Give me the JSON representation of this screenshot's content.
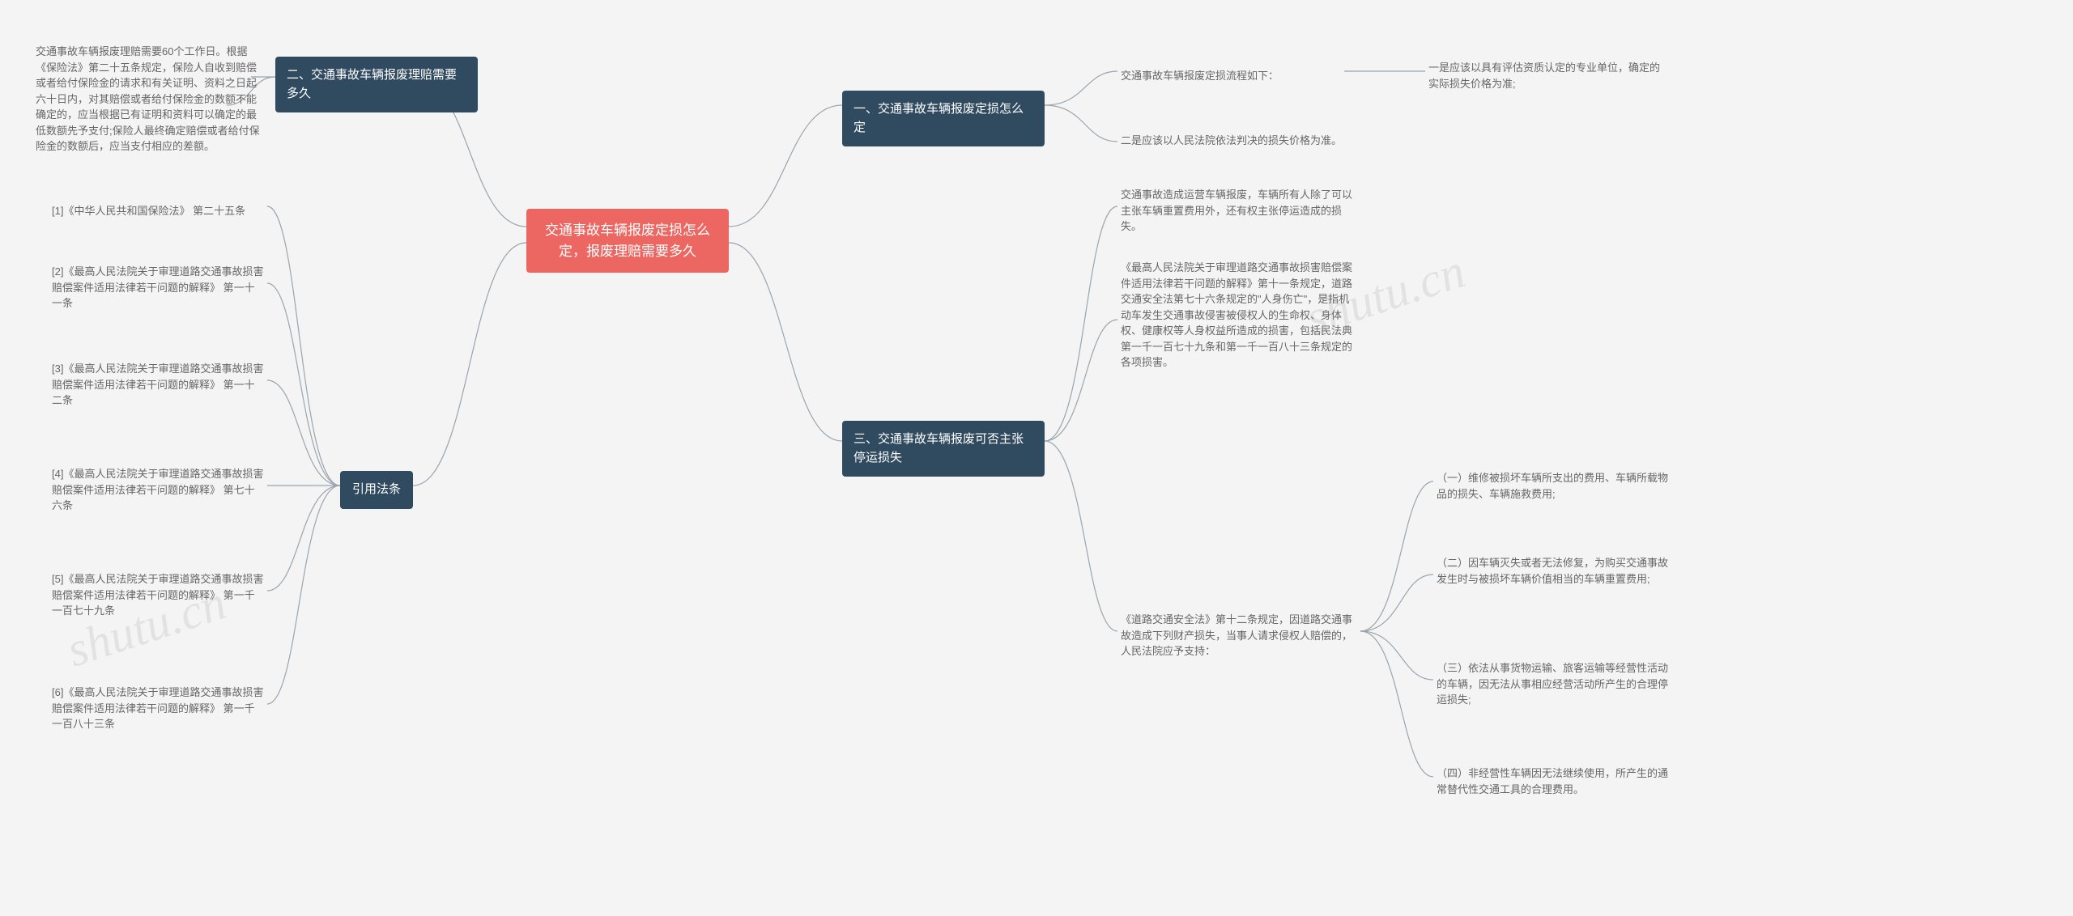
{
  "watermark": "shutu.cn",
  "root": "交通事故车辆报废定损怎么定，报废理赔需要多久",
  "right": {
    "section1": {
      "title": "一、交通事故车辆报废定损怎么定",
      "intro": "交通事故车辆报废定损流程如下：",
      "sub1": "一是应该以具有评估资质认定的专业单位，确定的实际损失价格为准;",
      "sub2": "二是应该以人民法院依法判决的损失价格为准。"
    },
    "section3": {
      "title": "三、交通事故车辆报废可否主张停运损失",
      "p1": "交通事故造成运营车辆报废，车辆所有人除了可以主张车辆重置费用外，还有权主张停运造成的损失。",
      "p2": "《最高人民法院关于审理道路交通事故损害赔偿案件适用法律若干问题的解释》第十一条规定，道路交通安全法第七十六条规定的\"人身伤亡\"，是指机动车发生交通事故侵害被侵权人的生命权、身体权、健康权等人身权益所造成的损害，包括民法典第一千一百七十九条和第一千一百八十三条规定的各项损害。",
      "p3": "《道路交通安全法》第十二条规定，因道路交通事故造成下列财产损失，当事人请求侵权人赔偿的，人民法院应予支持：",
      "p3_items": {
        "a": "（一）维修被损坏车辆所支出的费用、车辆所载物品的损失、车辆施救费用;",
        "b": "（二）因车辆灭失或者无法修复，为购买交通事故发生时与被损坏车辆价值相当的车辆重置费用;",
        "c": "（三）依法从事货物运输、旅客运输等经营性活动的车辆，因无法从事相应经营活动所产生的合理停运损失;",
        "d": "（四）非经营性车辆因无法继续使用，所产生的通常替代性交通工具的合理费用。"
      }
    }
  },
  "left": {
    "section2": {
      "title": "二、交通事故车辆报废理赔需要多久",
      "body": "交通事故车辆报废理赔需要60个工作日。根据《保险法》第二十五条规定，保险人自收到赔偿或者给付保险金的请求和有关证明、资料之日起六十日内，对其赔偿或者给付保险金的数额不能确定的，应当根据已有证明和资料可以确定的最低数额先予支付;保险人最终确定赔偿或者给付保险金的数额后，应当支付相应的差额。"
    },
    "refs": {
      "title": "引用法条",
      "items": {
        "r1": "[1]《中华人民共和国保险法》 第二十五条",
        "r2": "[2]《最高人民法院关于审理道路交通事故损害赔偿案件适用法律若干问题的解释》 第一十一条",
        "r3": "[3]《最高人民法院关于审理道路交通事故损害赔偿案件适用法律若干问题的解释》 第一十二条",
        "r4": "[4]《最高人民法院关于审理道路交通事故损害赔偿案件适用法律若干问题的解释》 第七十六条",
        "r5": "[5]《最高人民法院关于审理道路交通事故损害赔偿案件适用法律若干问题的解释》 第一千一百七十九条",
        "r6": "[6]《最高人民法院关于审理道路交通事故损害赔偿案件适用法律若干问题的解释》 第一千一百八十三条"
      }
    }
  }
}
